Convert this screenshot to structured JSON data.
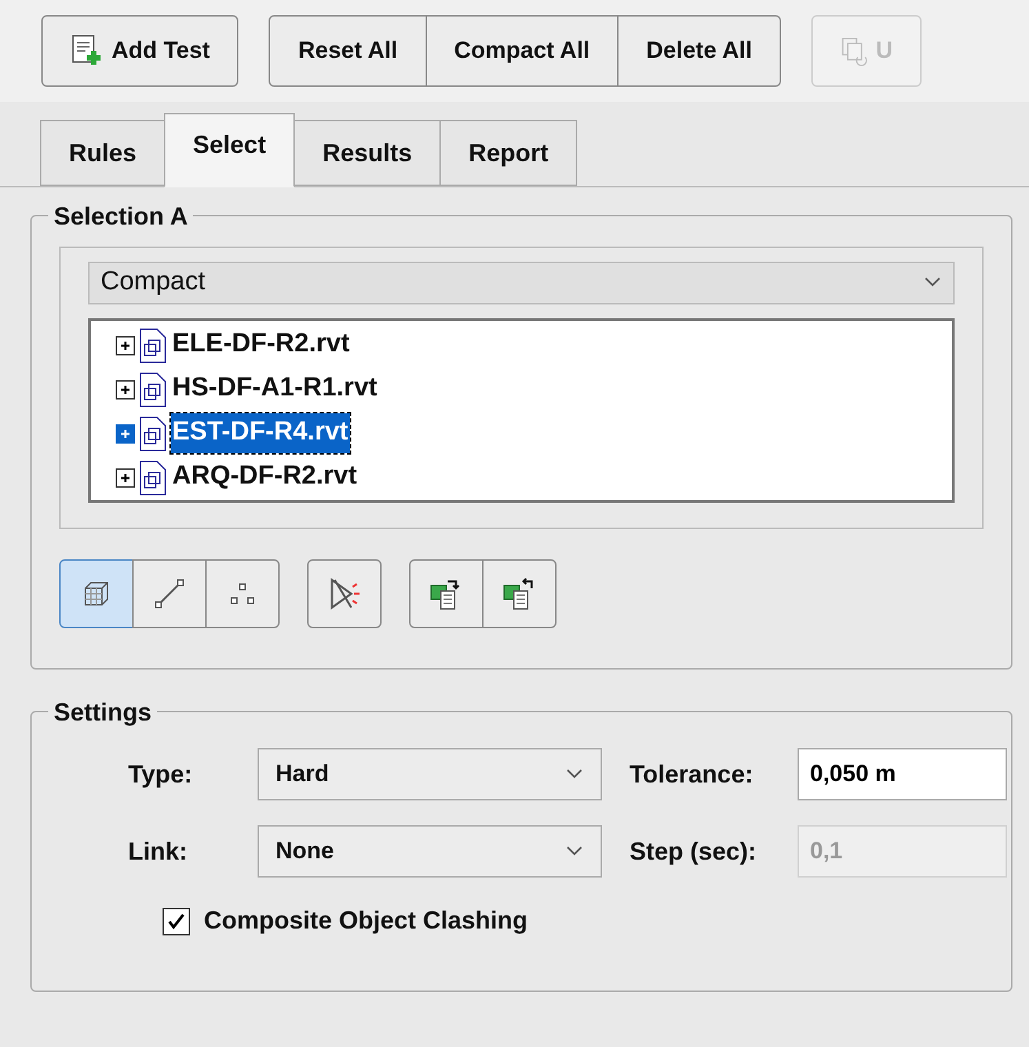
{
  "toolbar": {
    "groups": [
      {
        "buttons": [
          {
            "label": "Add Test",
            "kind": "add",
            "disabled": false
          }
        ]
      },
      {
        "buttons": [
          {
            "label": "Reset All",
            "kind": "plain",
            "disabled": false
          },
          {
            "label": "Compact All",
            "kind": "plain",
            "disabled": false
          },
          {
            "label": "Delete All",
            "kind": "plain",
            "disabled": false
          }
        ]
      },
      {
        "buttons": [
          {
            "label": "U",
            "kind": "update",
            "disabled": true
          }
        ]
      }
    ]
  },
  "tabs": [
    {
      "label": "Rules",
      "selected": false
    },
    {
      "label": "Select",
      "selected": true
    },
    {
      "label": "Results",
      "selected": false
    },
    {
      "label": "Report",
      "selected": false
    }
  ],
  "selection_a": {
    "title": "Selection A",
    "dropdown": {
      "value": "Compact"
    },
    "tree": [
      {
        "label": "ELE-DF-R2.rvt",
        "selected": false,
        "expanded": false
      },
      {
        "label": "HS-DF-A1-R1.rvt",
        "selected": false,
        "expanded": false
      },
      {
        "label": "EST-DF-R4.rvt",
        "selected": true,
        "expanded": false
      },
      {
        "label": "ARQ-DF-R2.rvt",
        "selected": false,
        "expanded": false
      }
    ],
    "tool_groups": [
      {
        "tools": [
          {
            "kind": "surfaces",
            "selected": true
          },
          {
            "kind": "lines",
            "selected": false
          },
          {
            "kind": "points",
            "selected": false
          }
        ]
      },
      {
        "tools": [
          {
            "kind": "self",
            "selected": false
          }
        ]
      },
      {
        "tools": [
          {
            "kind": "save",
            "selected": false
          },
          {
            "kind": "load",
            "selected": false
          }
        ]
      }
    ]
  },
  "settings": {
    "title": "Settings",
    "type": {
      "label": "Type:",
      "value": "Hard"
    },
    "tolerance": {
      "label": "Tolerance:",
      "value": "0,050 m",
      "disabled": false
    },
    "link": {
      "label": "Link:",
      "value": "None"
    },
    "step": {
      "label": "Step (sec):",
      "value": "0,1",
      "disabled": true
    },
    "composite": {
      "label": "Composite Object Clashing",
      "checked": true
    }
  }
}
